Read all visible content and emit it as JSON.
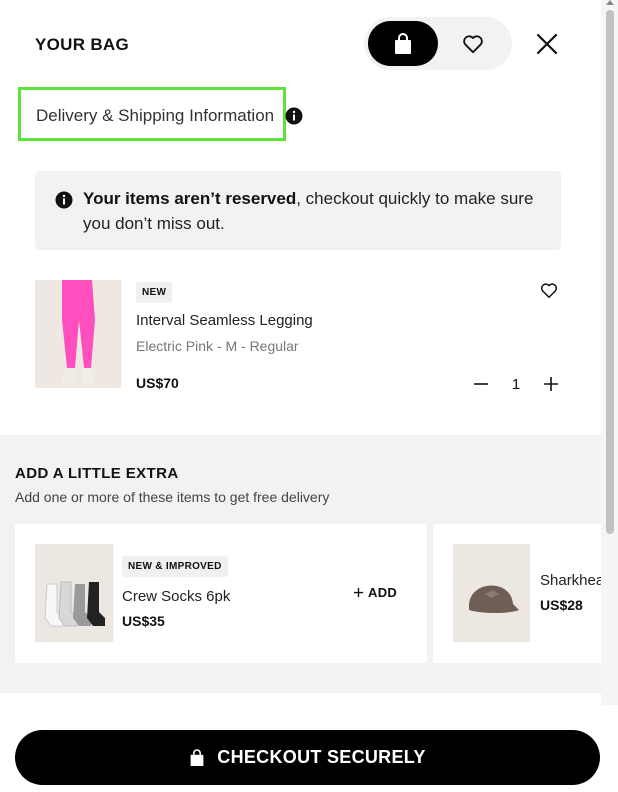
{
  "header": {
    "title": "YOUR BAG",
    "bag_tab_icon": "shopping-bag-icon",
    "wishlist_tab_icon": "heart-icon",
    "close_icon": "close-icon"
  },
  "delivery": {
    "link_text": "Delivery & Shipping Information",
    "info_icon": "info-icon",
    "highlight_color": "#5ee33a"
  },
  "notice": {
    "bold_text": "Your items aren’t reserved",
    "rest_text": ", checkout quickly to make sure you don’t miss out."
  },
  "bag_item": {
    "badge": "NEW",
    "name": "Interval Seamless Legging",
    "variant": "Electric Pink - M - Regular",
    "price": "US$70",
    "quantity": "1",
    "product_color": "#ff4fbf"
  },
  "extras": {
    "title": "ADD A LITTLE EXTRA",
    "subtitle": "Add one or more of these items to get free delivery",
    "cards": [
      {
        "badge": "NEW & IMPROVED",
        "name": "Crew Socks 6pk",
        "price": "US$35",
        "add_label": "ADD"
      },
      {
        "name": "Sharkhead Cap",
        "price": "US$28"
      }
    ]
  },
  "checkout": {
    "label": "CHECKOUT SECURELY",
    "icon": "shopping-bag-icon"
  }
}
